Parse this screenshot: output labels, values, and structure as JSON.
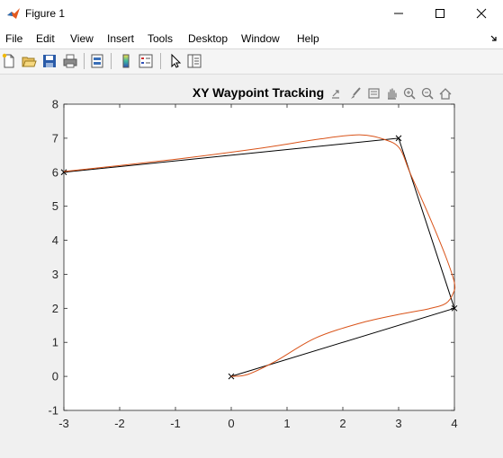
{
  "window": {
    "title": "Figure 1"
  },
  "menu": [
    "File",
    "Edit",
    "View",
    "Insert",
    "Tools",
    "Desktop",
    "Window",
    "Help"
  ],
  "chart_data": {
    "type": "line",
    "title": "XY Waypoint Tracking",
    "xlim": [
      -3,
      4
    ],
    "ylim": [
      -1,
      8
    ],
    "xticks": [
      "-3",
      "-2",
      "-1",
      "0",
      "1",
      "2",
      "3",
      "4"
    ],
    "yticks": [
      "-1",
      "0",
      "1",
      "2",
      "3",
      "4",
      "5",
      "6",
      "7",
      "8"
    ],
    "grid": false,
    "series": [
      {
        "color": "#000000",
        "marker": "x",
        "x": [
          0,
          4,
          3,
          -3
        ],
        "y": [
          0,
          2,
          7,
          6
        ]
      },
      {
        "color": "#d95319",
        "marker": "none",
        "x": [
          0.0,
          0.3,
          0.8,
          1.5,
          2.3,
          3.0,
          3.55,
          3.85,
          3.98,
          4.0,
          3.85,
          3.55,
          3.2,
          3.02,
          2.75,
          2.3,
          1.6,
          0.5,
          -1.0,
          -3.0
        ],
        "y": [
          0.0,
          0.06,
          0.45,
          1.12,
          1.56,
          1.82,
          1.99,
          2.15,
          2.45,
          2.75,
          3.5,
          4.7,
          6.0,
          6.7,
          6.96,
          7.1,
          6.98,
          6.7,
          6.38,
          6.02
        ]
      }
    ]
  }
}
